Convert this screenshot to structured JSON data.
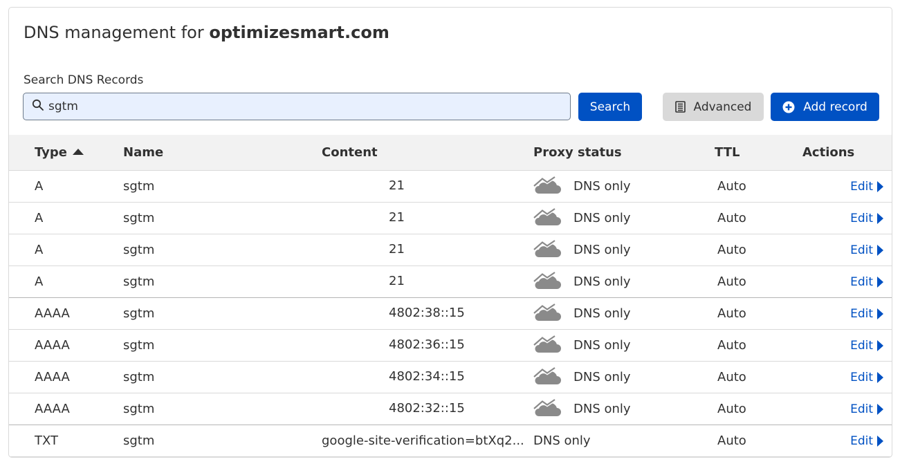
{
  "header": {
    "title_prefix": "DNS management for",
    "domain": "optimizesmart.com"
  },
  "search": {
    "label": "Search DNS Records",
    "value": "sgtm",
    "placeholder": ""
  },
  "buttons": {
    "search": "Search",
    "advanced": "Advanced",
    "add_record": "Add record"
  },
  "table": {
    "columns": [
      "Type",
      "Name",
      "Content",
      "Proxy status",
      "TTL",
      "Actions"
    ],
    "sort_column": "Type",
    "rows": [
      {
        "type": "A",
        "name": "sgtm",
        "content_start": "2",
        "content_end": "21",
        "proxy": "DNS only",
        "proxy_icon": "cloud-off-icon",
        "ttl": "Auto",
        "action": "Edit"
      },
      {
        "type": "A",
        "name": "sgtm",
        "content_start": "2",
        "content_end": "21",
        "proxy": "DNS only",
        "proxy_icon": "cloud-off-icon",
        "ttl": "Auto",
        "action": "Edit"
      },
      {
        "type": "A",
        "name": "sgtm",
        "content_start": "2",
        "content_end": "21",
        "proxy": "DNS only",
        "proxy_icon": "cloud-off-icon",
        "ttl": "Auto",
        "action": "Edit"
      },
      {
        "type": "A",
        "name": "sgtm",
        "content_start": "2",
        "content_end": "21",
        "proxy": "DNS only",
        "proxy_icon": "cloud-off-icon",
        "ttl": "Auto",
        "action": "Edit"
      },
      {
        "type": "AAAA",
        "name": "sgtm",
        "content_start": "2",
        "content_end": "4802:38::15",
        "proxy": "DNS only",
        "proxy_icon": "cloud-off-icon",
        "ttl": "Auto",
        "action": "Edit"
      },
      {
        "type": "AAAA",
        "name": "sgtm",
        "content_start": "2",
        "content_end": "4802:36::15",
        "proxy": "DNS only",
        "proxy_icon": "cloud-off-icon",
        "ttl": "Auto",
        "action": "Edit"
      },
      {
        "type": "AAAA",
        "name": "sgtm",
        "content_start": "2",
        "content_end": "4802:34::15",
        "proxy": "DNS only",
        "proxy_icon": "cloud-off-icon",
        "ttl": "Auto",
        "action": "Edit"
      },
      {
        "type": "AAAA",
        "name": "sgtm",
        "content_start": "2",
        "content_end": "4802:32::15",
        "proxy": "DNS only",
        "proxy_icon": "cloud-off-icon",
        "ttl": "Auto",
        "action": "Edit"
      },
      {
        "type": "TXT",
        "name": "sgtm",
        "content_full": "google-site-verification=btXq2...",
        "proxy": "DNS only",
        "proxy_icon": "",
        "ttl": "Auto",
        "action": "Edit"
      }
    ]
  },
  "colors": {
    "primary": "#0051c3",
    "search_bg": "#e8f0fe",
    "header_bg": "#f2f2f2",
    "cloud": "#8a8a8a",
    "text": "#313131"
  }
}
